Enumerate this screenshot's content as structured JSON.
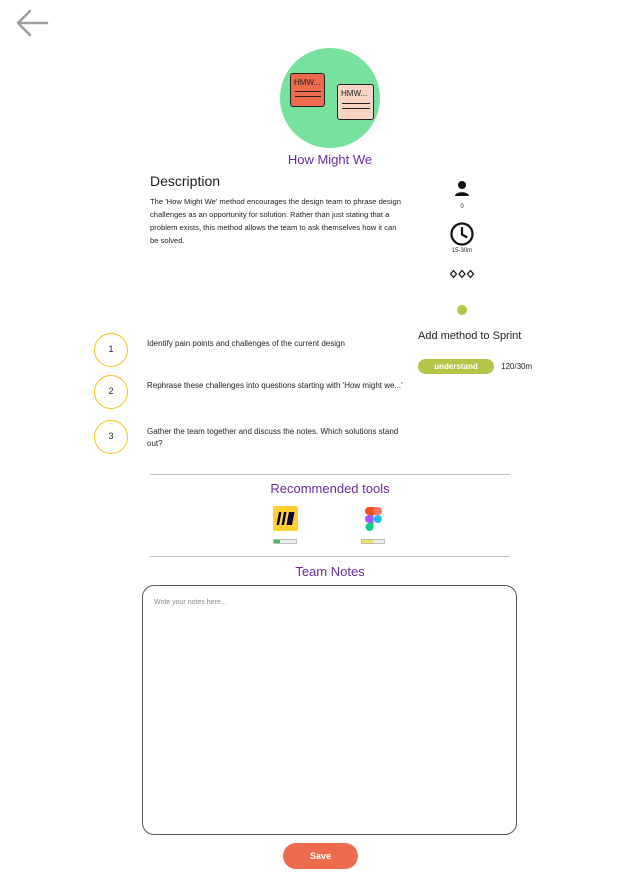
{
  "nav": {
    "back_icon": "arrow-left-icon",
    "icon_color": "#9e9e9e"
  },
  "method": {
    "title": "How Might We",
    "illustration": {
      "icon": "sticky-notes-icon",
      "bg_color": "#77e29d",
      "note_label_1": "HMW...",
      "note_label_2": "HMW..."
    }
  },
  "description": {
    "heading": "Description",
    "text": "The 'How Might We' method encourages the design team to phrase design challenges as an opportunity for solution. Rather than just stating that a problem exists, this method allows the team to ask themselves how it can be solved."
  },
  "stats": {
    "participants": {
      "icon": "person-icon",
      "value": "0"
    },
    "duration": {
      "icon": "clock-icon",
      "value": "15-30m"
    },
    "difficulty": {
      "icon": "diamonds-icon",
      "filled": 0,
      "total": 3
    },
    "sprint_dot_color": "#b4c548"
  },
  "sprint": {
    "add_label": "Add method to Sprint",
    "phase_label": "understand",
    "phase_color": "#b4c548",
    "time_value": "120/30m"
  },
  "steps": [
    {
      "number": "1",
      "text": "Identify pain points and challenges of the current design"
    },
    {
      "number": "2",
      "text": "Rephrase these challenges into questions starting with 'How might we...'"
    },
    {
      "number": "3",
      "text": "Gather the team together and discuss the notes. Which solutions stand out?"
    }
  ],
  "tools": {
    "heading": "Recommended tools",
    "items": [
      {
        "name": "Miro",
        "icon": "miro-logo-icon",
        "rating": 0.25,
        "rating_color": "#3fbf5a"
      },
      {
        "name": "Figma",
        "icon": "figma-logo-icon",
        "rating": 0.55,
        "rating_color": "#f0e25a"
      }
    ]
  },
  "notes": {
    "heading": "Team Notes",
    "placeholder": "Write your notes here...",
    "save_label": "Save"
  }
}
